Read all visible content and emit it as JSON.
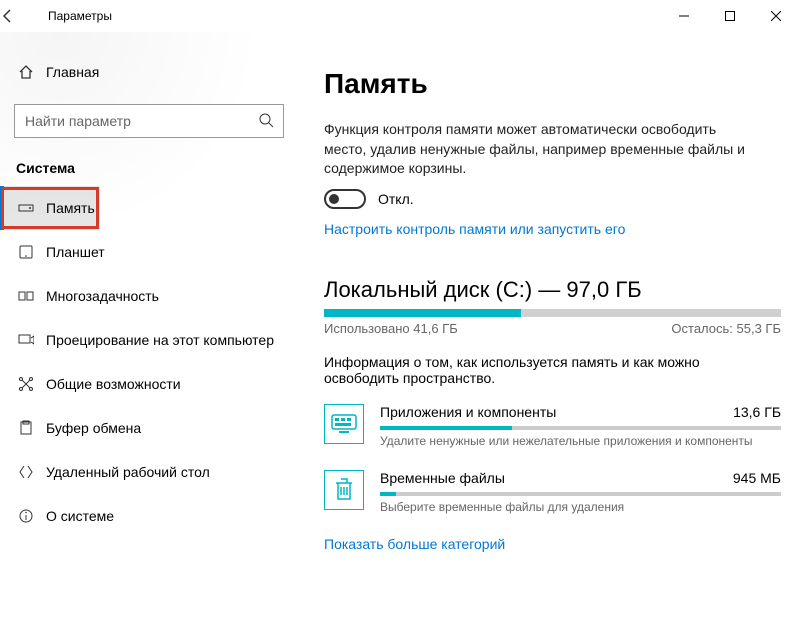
{
  "window": {
    "title": "Параметры"
  },
  "sidebar": {
    "home": "Главная",
    "search_placeholder": "Найти параметр",
    "section": "Система",
    "items": [
      {
        "label": "Память"
      },
      {
        "label": "Планшет"
      },
      {
        "label": "Многозадачность"
      },
      {
        "label": "Проецирование на этот компьютер"
      },
      {
        "label": "Общие возможности"
      },
      {
        "label": "Буфер обмена"
      },
      {
        "label": "Удаленный рабочий стол"
      },
      {
        "label": "О системе"
      }
    ]
  },
  "page": {
    "title": "Память",
    "storage_sense_desc": "Функция контроля памяти может автоматически освободить место, удалив ненужные файлы, например временные файлы и содержимое корзины.",
    "toggle_state": "Откл.",
    "configure_link": "Настроить контроль памяти или запустить его",
    "disk": {
      "label": "Локальный диск (C:) — 97,0 ГБ",
      "used_label": "Использовано 41,6 ГБ",
      "free_label": "Осталось: 55,3 ГБ",
      "used_pct": 43,
      "desc": "Информация о том, как используется память и как можно освободить пространство."
    },
    "categories": [
      {
        "name": "Приложения и компоненты",
        "size": "13,6 ГБ",
        "pct": 33,
        "hint": "Удалите ненужные или нежелательные приложения и компоненты"
      },
      {
        "name": "Временные файлы",
        "size": "945 МБ",
        "pct": 4,
        "hint": "Выберите временные файлы для удаления"
      }
    ],
    "more_link": "Показать больше категорий"
  }
}
